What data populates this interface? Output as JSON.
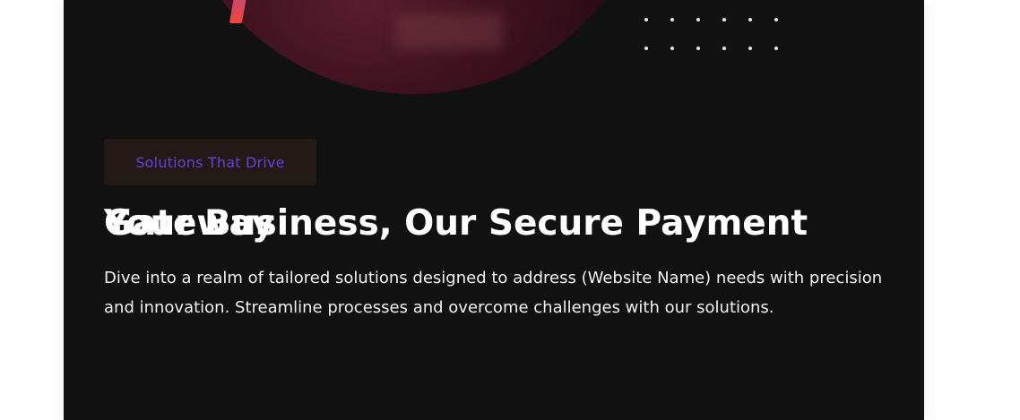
{
  "hero": {
    "tag_label": "Solutions That Drive",
    "headline_line1": "Your Business, Our Secure Payment",
    "headline_line2": "Gateway",
    "description": "Dive into a realm of tailored solutions designed to address (Website Name) needs with precision and innovation. Streamline processes and overcome challenges with our solutions."
  },
  "colors": {
    "card_background": "#111111",
    "tag_background": "#231a17",
    "tag_text": "#6b3fd6",
    "text": "#ffffff"
  }
}
